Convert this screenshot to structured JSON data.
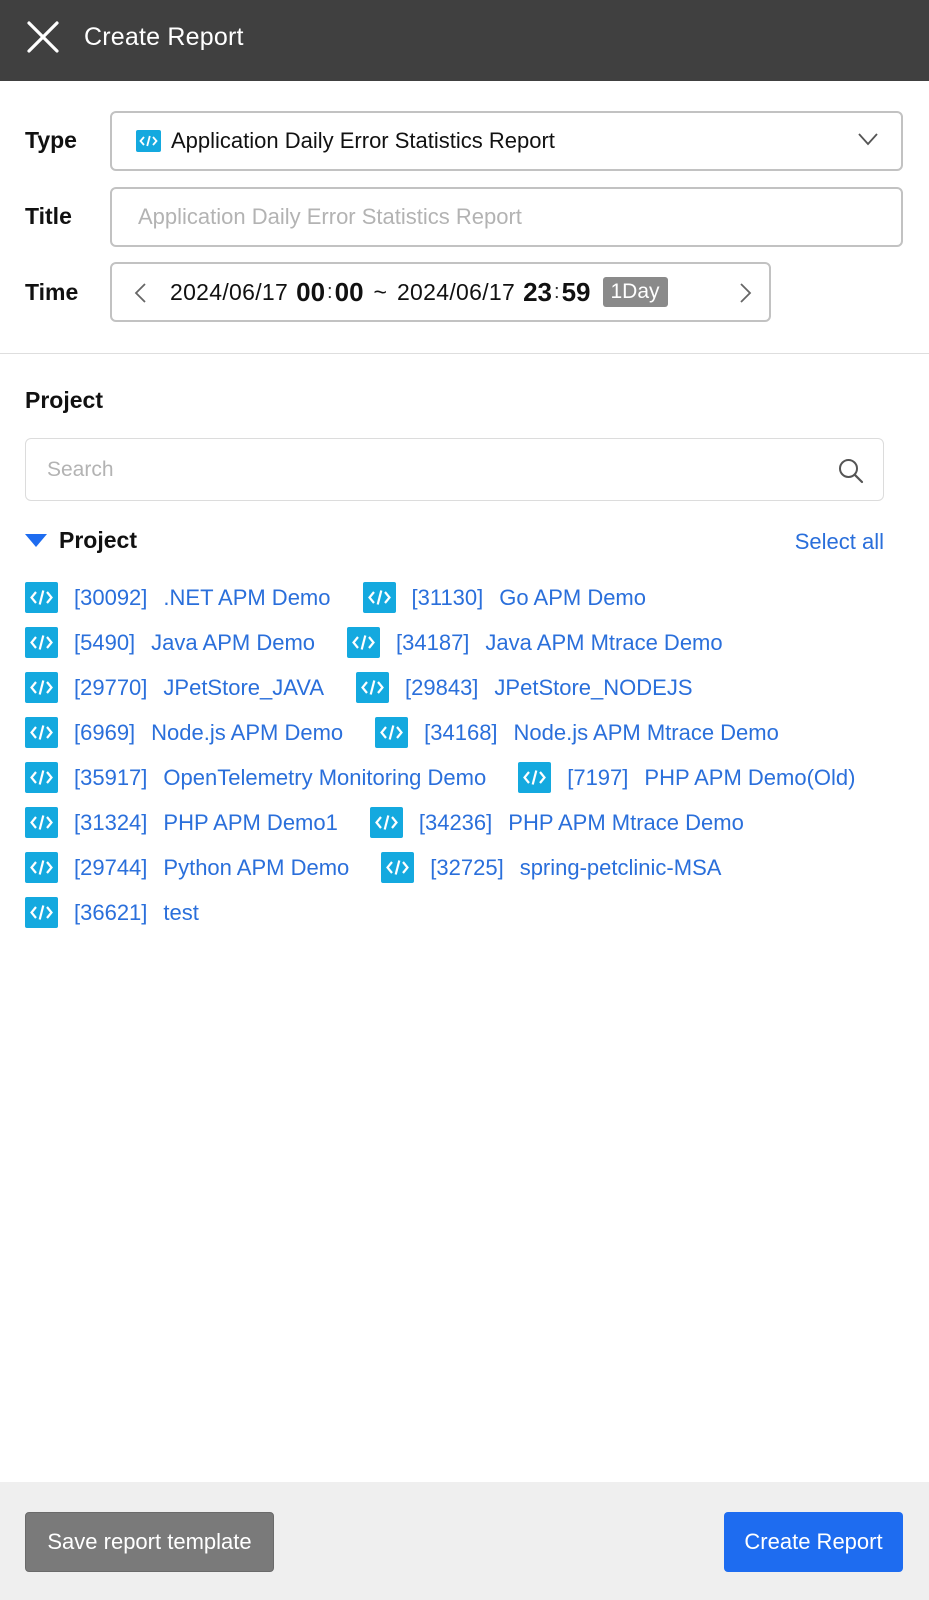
{
  "header": {
    "title": "Create Report",
    "close_icon": "close-icon"
  },
  "form": {
    "type_label": "Type",
    "type_value": "Application Daily Error Statistics Report",
    "title_label": "Title",
    "title_value": "",
    "title_placeholder": "Application Daily Error Statistics Report",
    "time_label": "Time",
    "time": {
      "start_date": "2024/06/17",
      "start_hour": "00",
      "start_minute": "00",
      "separator": "~",
      "end_date": "2024/06/17",
      "end_hour": "23",
      "end_minute": "59",
      "range_badge": "1Day"
    }
  },
  "project_section": {
    "title": "Project",
    "search_placeholder": "Search",
    "search_value": "",
    "tree_label": "Project",
    "select_all_label": "Select all",
    "rows": [
      [
        {
          "id": "[30092]",
          "name": ".NET APM Demo"
        },
        {
          "id": "[31130]",
          "name": "Go APM Demo"
        }
      ],
      [
        {
          "id": "[5490]",
          "name": "Java APM Demo"
        },
        {
          "id": "[34187]",
          "name": "Java APM Mtrace Demo"
        }
      ],
      [
        {
          "id": "[29770]",
          "name": "JPetStore_JAVA"
        },
        {
          "id": "[29843]",
          "name": "JPetStore_NODEJS"
        }
      ],
      [
        {
          "id": "[6969]",
          "name": "Node.js APM Demo"
        },
        {
          "id": "[34168]",
          "name": "Node.js APM Mtrace Demo"
        }
      ],
      [
        {
          "id": "[35917]",
          "name": "OpenTelemetry Monitoring Demo"
        },
        {
          "id": "[7197]",
          "name": "PHP APM Demo(Old)"
        }
      ],
      [
        {
          "id": "[31324]",
          "name": "PHP APM Demo1"
        },
        {
          "id": "[34236]",
          "name": "PHP APM Mtrace Demo"
        }
      ],
      [
        {
          "id": "[29744]",
          "name": "Python APM Demo"
        },
        {
          "id": "[32725]",
          "name": "spring-petclinic-MSA"
        }
      ],
      [
        {
          "id": "[36621]",
          "name": "test"
        }
      ]
    ]
  },
  "footer": {
    "save_template_label": "Save report template",
    "create_report_label": "Create Report"
  },
  "colors": {
    "header_bg": "#404040",
    "link_blue": "#2a6fdb",
    "primary_button": "#1e6cf0",
    "icon_cyan": "#14a9df",
    "secondary_button": "#7a7a7a"
  }
}
